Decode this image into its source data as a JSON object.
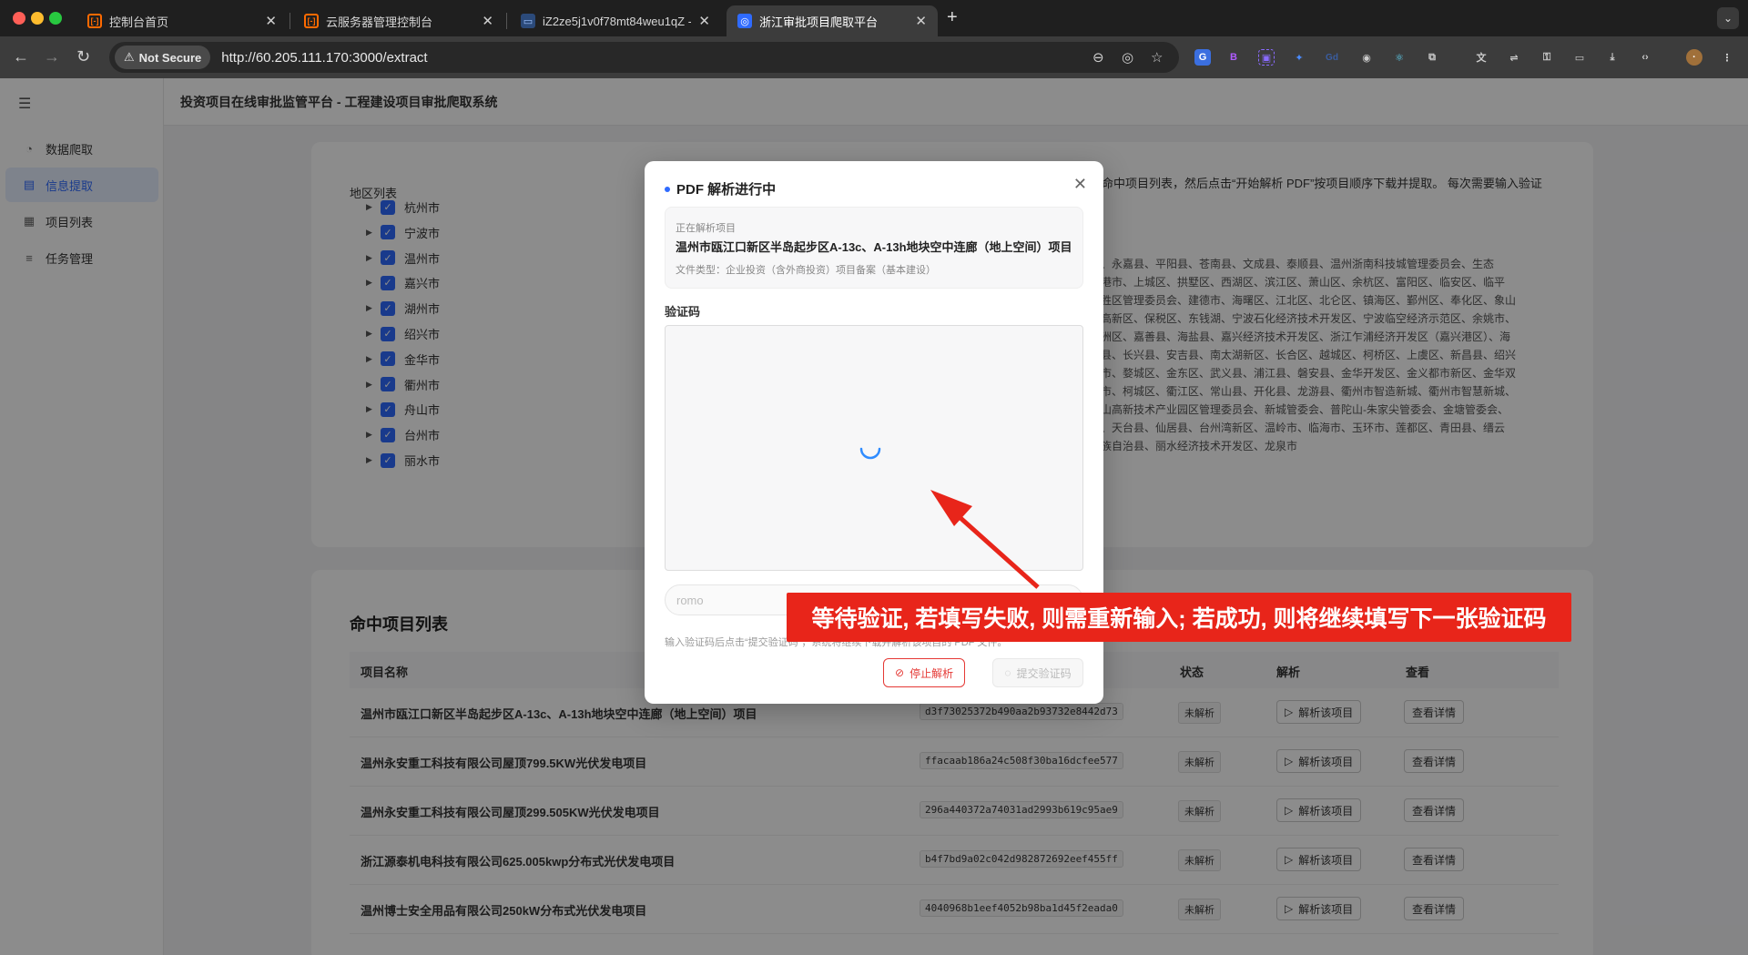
{
  "browser": {
    "tabs": [
      {
        "title": "控制台首页",
        "active": false
      },
      {
        "title": "云服务器管理控制台",
        "active": false
      },
      {
        "title": "iZ2ze5j1v0f78mt84weu1qZ -",
        "active": false
      },
      {
        "title": "浙江审批项目爬取平台",
        "active": true
      }
    ],
    "security_label": "Not Secure",
    "url": "http://60.205.111.170:3000/extract"
  },
  "sidebar": {
    "items": [
      {
        "label": "数据爬取",
        "icon": "dashboard-icon",
        "active": false
      },
      {
        "label": "信息提取",
        "icon": "document-icon",
        "active": true
      },
      {
        "label": "项目列表",
        "icon": "table-icon",
        "active": false
      },
      {
        "label": "任务管理",
        "icon": "list-icon",
        "active": false
      }
    ]
  },
  "header": {
    "title": "投资项目在线审批监管平台 - 工程建设项目审批爬取系统"
  },
  "regions": {
    "title": "地区列表",
    "items": [
      "杭州市",
      "宁波市",
      "温州市",
      "嘉兴市",
      "湖州市",
      "绍兴市",
      "金华市",
      "衢州市",
      "舟山市",
      "台州市",
      "丽水市"
    ],
    "instruction_fragment": "或命中项目列表，然后点击“开始解析 PDF”按项目顺序下载并提取。 每次需要输入验证码",
    "county_lines": [
      "区、永嘉县、平阳县、苍南县、文成县、泰顺县、温州浙南科技城管理委员会、生态",
      "龙港市、上城区、拱墅区、西湖区、滨江区、萧山区、余杭区、富阳区、临安区、临平",
      "名胜区管理委员会、建德市、海曙区、江北区、北仑区、镇海区、鄞州区、奉化区、象山",
      "波高新区、保税区、东钱湖、宁波石化经济技术开发区、宁波临空经济示范区、余姚市、",
      "秀洲区、嘉善县、海盐县、嘉兴经济技术开发区、浙江乍浦经济开发区（嘉兴港区）、海",
      "清县、长兴县、安吉县、南太湖新区、长合区、越城区、柯桥区、上虞区、新昌县、绍兴",
      "州市、婺城区、金东区、武义县、浦江县、磐安县、金华开发区、金义都市新区、金华双",
      "建市、柯城区、衢江区、常山县、开化县、龙游县、衢州市智造新城、衢州市智慧新城、",
      "舟山高新技术产业园区管理委员会、新城管委会、普陀山-朱家尖管委会、金塘管委会、",
      "县、天台县、仙居县、台州湾新区、温岭市、临海市、玉环市、莲都区、青田县、缙云",
      "畲族自治县、丽水经济技术开发区、龙泉市"
    ]
  },
  "hits": {
    "title": "命中项目列表",
    "columns": {
      "name": "项目名称",
      "status": "状态",
      "parse": "解析",
      "view": "查看"
    },
    "rows": [
      {
        "name": "温州市瓯江口新区半岛起步区A-13c、A-13h地块空中连廊（地上空间）项目",
        "hash": "d3f73025372b490aa2b93732e8442d73",
        "status": "未解析",
        "parse": "解析该项目",
        "view": "查看详情"
      },
      {
        "name": "温州永安重工科技有限公司屋顶799.5KW光伏发电项目",
        "hash": "ffacaab186a24c508f30ba16dcfee577",
        "status": "未解析",
        "parse": "解析该项目",
        "view": "查看详情"
      },
      {
        "name": "温州永安重工科技有限公司屋顶299.505KW光伏发电项目",
        "hash": "296a440372a74031ad2993b619c95ae9",
        "status": "未解析",
        "parse": "解析该项目",
        "view": "查看详情"
      },
      {
        "name": "浙江源泰机电科技有限公司625.005kwp分布式光伏发电项目",
        "hash": "b4f7bd9a02c042d982872692eef455ff",
        "status": "未解析",
        "parse": "解析该项目",
        "view": "查看详情"
      },
      {
        "name": "温州博士安全用品有限公司250kW分布式光伏发电项目",
        "hash": "4040968b1eef4052b98ba1d45f2eada0",
        "status": "未解析",
        "parse": "解析该项目",
        "view": "查看详情"
      }
    ]
  },
  "modal": {
    "title": "PDF 解析进行中",
    "current_label": "正在解析项目",
    "current_project": "温州市瓯江口新区半岛起步区A-13c、A-13h地块空中连廊（地上空间）项目",
    "file_type": "文件类型：企业投资（含外商投资）项目备案（基本建设）",
    "captcha_label": "验证码",
    "captcha_value": "romo",
    "hint": "输入验证码后点击“提交验证码”，系统将继续下载并解析该项目的 PDF 文件。",
    "stop_label": "停止解析",
    "submit_label": "提交验证码"
  },
  "annotation": {
    "text": "等待验证, 若填写失败, 则需重新输入; 若成功, 则将继续填写下一张验证码"
  },
  "colors": {
    "accent": "#2f6bff",
    "danger": "#e53935",
    "annotation": "#e8251a"
  }
}
